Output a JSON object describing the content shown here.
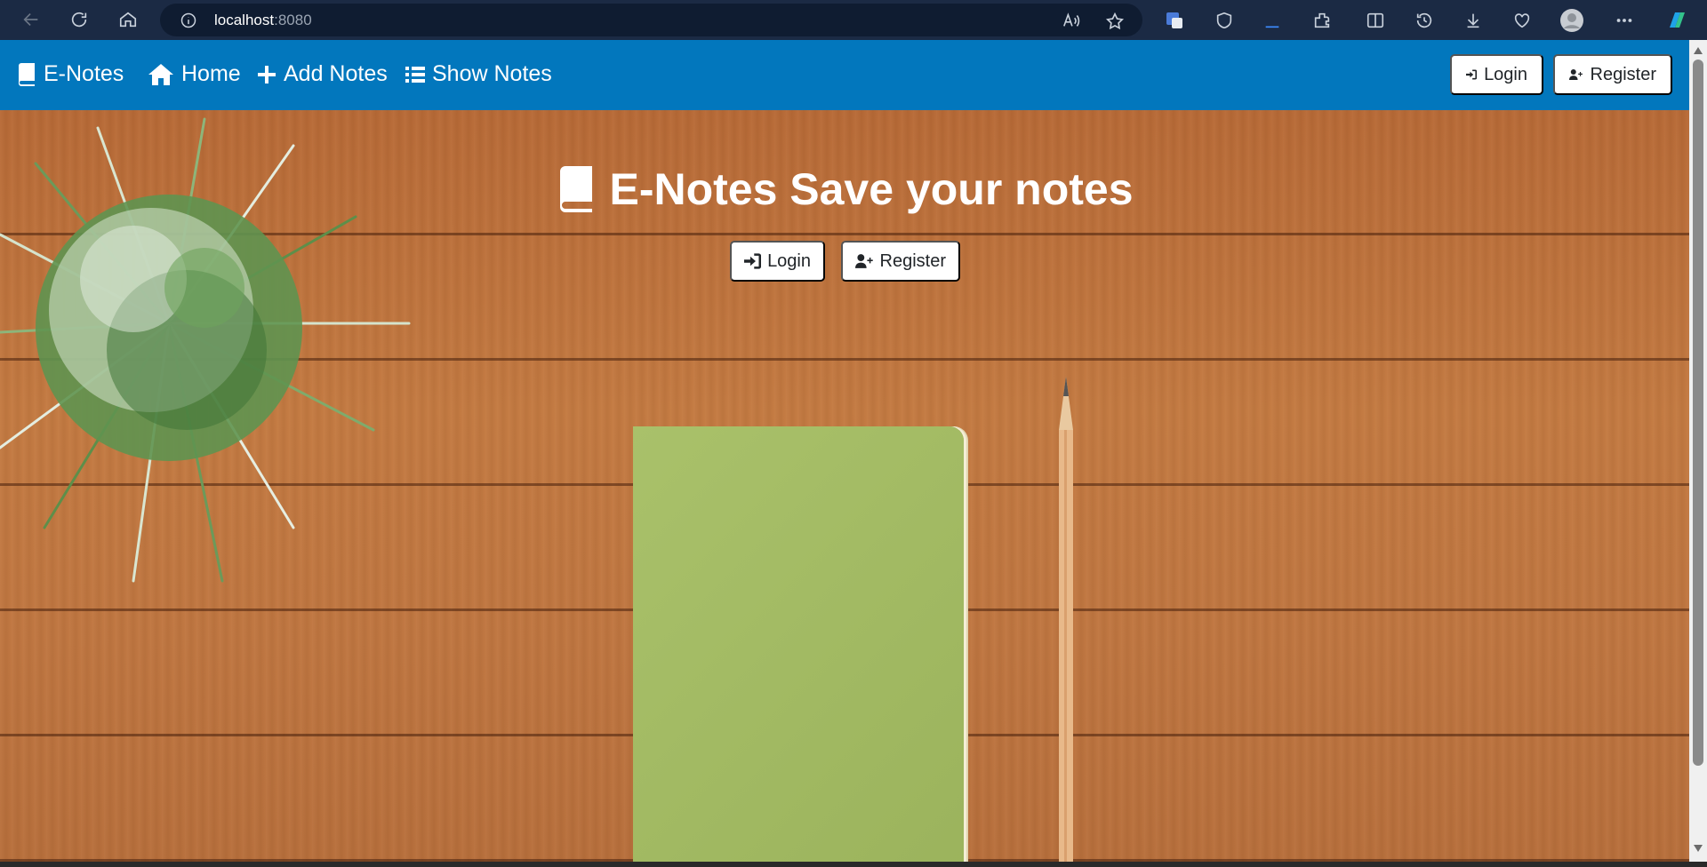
{
  "browser": {
    "url_host": "localhost",
    "url_port": ":8080",
    "icons": [
      "back-icon",
      "refresh-icon",
      "home-icon",
      "info-icon",
      "read-aloud-icon",
      "favorite-star-icon",
      "translate-icon",
      "shield-icon",
      "extensions-icon",
      "split-screen-icon",
      "history-icon",
      "download-icon",
      "health-icon",
      "profile-icon",
      "more-icon",
      "copilot-icon"
    ]
  },
  "navbar": {
    "brand": "E-Notes",
    "home": "Home",
    "add_notes": "Add Notes",
    "show_notes": "Show Notes",
    "login": "Login",
    "register": "Register",
    "color": "#0277bd"
  },
  "hero": {
    "title": "E-Notes Save your notes",
    "login": "Login",
    "register": "Register"
  }
}
